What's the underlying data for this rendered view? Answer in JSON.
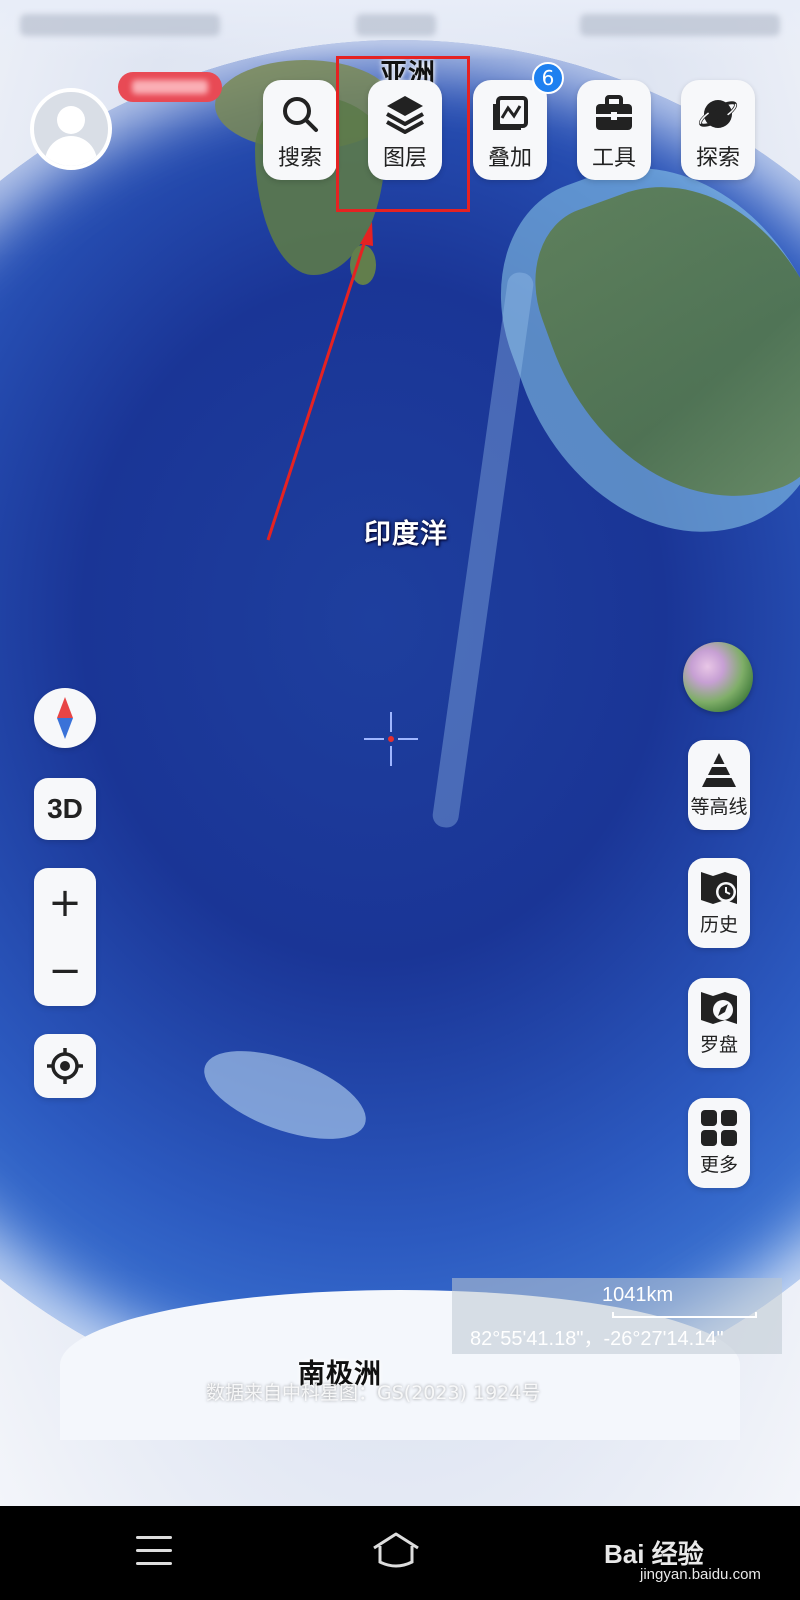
{
  "toolbar": {
    "items": [
      {
        "label": "搜索",
        "icon": "search-icon"
      },
      {
        "label": "图层",
        "icon": "layers-icon"
      },
      {
        "label": "叠加",
        "icon": "overlay-icon"
      },
      {
        "label": "工具",
        "icon": "toolbox-icon"
      },
      {
        "label": "探索",
        "icon": "planet-icon"
      }
    ],
    "overlay_badge": "6",
    "highlighted_item": "图层",
    "highlight_color": "#e52222"
  },
  "map": {
    "labels": {
      "asia": "亚洲",
      "indian_ocean": "印度洋",
      "antarctica": "南极洲"
    },
    "scale": "1041km",
    "coordinates": "82°55'41.18\"，-26°27'14.14\"",
    "source": "数据来自中科星图：GS(2023) 1924号"
  },
  "left_controls": {
    "compass": "compass-icon",
    "mode": "3D",
    "zoom_in": "+",
    "zoom_out": "−",
    "locate": "locate-icon"
  },
  "right_controls": [
    {
      "label": "等高线",
      "icon": "contour-icon"
    },
    {
      "label": "历史",
      "icon": "history-icon"
    },
    {
      "label": "罗盘",
      "icon": "compass-map-icon"
    },
    {
      "label": "更多",
      "icon": "grid-icon"
    }
  ],
  "watermark": {
    "brand": "Bai 经验",
    "url": "jingyan.baidu.com"
  },
  "colors": {
    "accent": "#1e80f0",
    "ocean": "#1a3596"
  }
}
